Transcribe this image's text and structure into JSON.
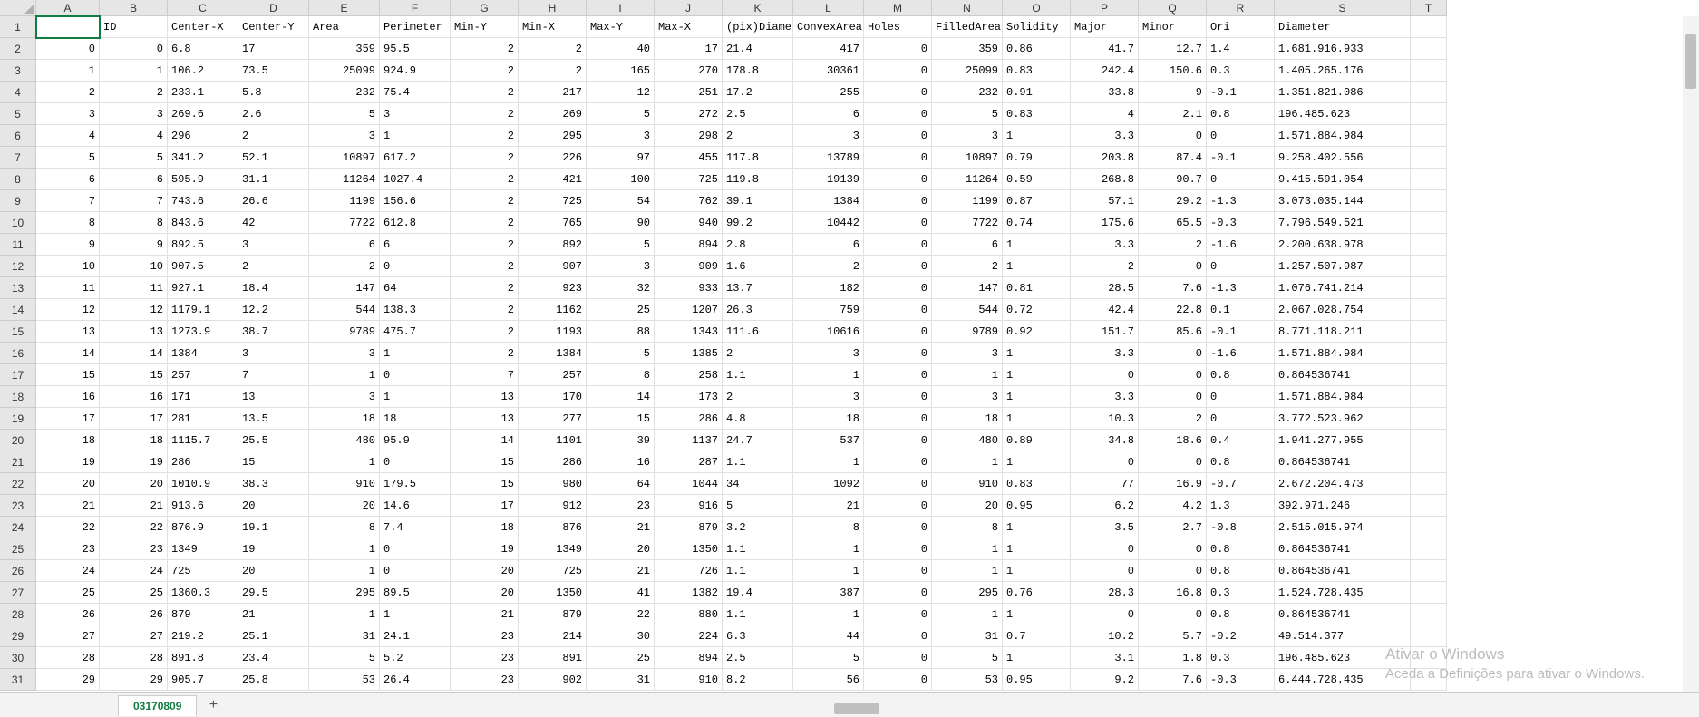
{
  "chart_data": {
    "type": "table",
    "columns": [
      "",
      "ID",
      "Center-X",
      "Center-Y",
      "Area",
      "Perimeter",
      "Min-Y",
      "Min-X",
      "Max-Y",
      "Max-X",
      "(pix)Diame",
      "ConvexArea",
      "Holes",
      "FilledArea",
      "Solidity",
      "Major",
      "Minor",
      "Ori",
      "Diameter"
    ],
    "rows": [
      [
        "0",
        "0",
        "6.8",
        "17",
        "359",
        "95.5",
        "2",
        "2",
        "40",
        "17",
        "21.4",
        "417",
        "0",
        "359",
        "0.86",
        "41.7",
        "12.7",
        "1.4",
        "1.681.916.933"
      ],
      [
        "1",
        "1",
        "106.2",
        "73.5",
        "25099",
        "924.9",
        "2",
        "2",
        "165",
        "270",
        "178.8",
        "30361",
        "0",
        "25099",
        "0.83",
        "242.4",
        "150.6",
        "0.3",
        "1.405.265.176"
      ],
      [
        "2",
        "2",
        "233.1",
        "5.8",
        "232",
        "75.4",
        "2",
        "217",
        "12",
        "251",
        "17.2",
        "255",
        "0",
        "232",
        "0.91",
        "33.8",
        "9",
        "-0.1",
        "1.351.821.086"
      ],
      [
        "3",
        "3",
        "269.6",
        "2.6",
        "5",
        "3",
        "2",
        "269",
        "5",
        "272",
        "2.5",
        "6",
        "0",
        "5",
        "0.83",
        "4",
        "2.1",
        "0.8",
        "196.485.623"
      ],
      [
        "4",
        "4",
        "296",
        "2",
        "3",
        "1",
        "2",
        "295",
        "3",
        "298",
        "2",
        "3",
        "0",
        "3",
        "1",
        "3.3",
        "0",
        "0",
        "1.571.884.984"
      ],
      [
        "5",
        "5",
        "341.2",
        "52.1",
        "10897",
        "617.2",
        "2",
        "226",
        "97",
        "455",
        "117.8",
        "13789",
        "0",
        "10897",
        "0.79",
        "203.8",
        "87.4",
        "-0.1",
        "9.258.402.556"
      ],
      [
        "6",
        "6",
        "595.9",
        "31.1",
        "11264",
        "1027.4",
        "2",
        "421",
        "100",
        "725",
        "119.8",
        "19139",
        "0",
        "11264",
        "0.59",
        "268.8",
        "90.7",
        "0",
        "9.415.591.054"
      ],
      [
        "7",
        "7",
        "743.6",
        "26.6",
        "1199",
        "156.6",
        "2",
        "725",
        "54",
        "762",
        "39.1",
        "1384",
        "0",
        "1199",
        "0.87",
        "57.1",
        "29.2",
        "-1.3",
        "3.073.035.144"
      ],
      [
        "8",
        "8",
        "843.6",
        "42",
        "7722",
        "612.8",
        "2",
        "765",
        "90",
        "940",
        "99.2",
        "10442",
        "0",
        "7722",
        "0.74",
        "175.6",
        "65.5",
        "-0.3",
        "7.796.549.521"
      ],
      [
        "9",
        "9",
        "892.5",
        "3",
        "6",
        "6",
        "2",
        "892",
        "5",
        "894",
        "2.8",
        "6",
        "0",
        "6",
        "1",
        "3.3",
        "2",
        "-1.6",
        "2.200.638.978"
      ],
      [
        "10",
        "10",
        "907.5",
        "2",
        "2",
        "0",
        "2",
        "907",
        "3",
        "909",
        "1.6",
        "2",
        "0",
        "2",
        "1",
        "2",
        "0",
        "0",
        "1.257.507.987"
      ],
      [
        "11",
        "11",
        "927.1",
        "18.4",
        "147",
        "64",
        "2",
        "923",
        "32",
        "933",
        "13.7",
        "182",
        "0",
        "147",
        "0.81",
        "28.5",
        "7.6",
        "-1.3",
        "1.076.741.214"
      ],
      [
        "12",
        "12",
        "1179.1",
        "12.2",
        "544",
        "138.3",
        "2",
        "1162",
        "25",
        "1207",
        "26.3",
        "759",
        "0",
        "544",
        "0.72",
        "42.4",
        "22.8",
        "0.1",
        "2.067.028.754"
      ],
      [
        "13",
        "13",
        "1273.9",
        "38.7",
        "9789",
        "475.7",
        "2",
        "1193",
        "88",
        "1343",
        "111.6",
        "10616",
        "0",
        "9789",
        "0.92",
        "151.7",
        "85.6",
        "-0.1",
        "8.771.118.211"
      ],
      [
        "14",
        "14",
        "1384",
        "3",
        "3",
        "1",
        "2",
        "1384",
        "5",
        "1385",
        "2",
        "3",
        "0",
        "3",
        "1",
        "3.3",
        "0",
        "-1.6",
        "1.571.884.984"
      ],
      [
        "15",
        "15",
        "257",
        "7",
        "1",
        "0",
        "7",
        "257",
        "8",
        "258",
        "1.1",
        "1",
        "0",
        "1",
        "1",
        "0",
        "0",
        "0.8",
        "0.864536741"
      ],
      [
        "16",
        "16",
        "171",
        "13",
        "3",
        "1",
        "13",
        "170",
        "14",
        "173",
        "2",
        "3",
        "0",
        "3",
        "1",
        "3.3",
        "0",
        "0",
        "1.571.884.984"
      ],
      [
        "17",
        "17",
        "281",
        "13.5",
        "18",
        "18",
        "13",
        "277",
        "15",
        "286",
        "4.8",
        "18",
        "0",
        "18",
        "1",
        "10.3",
        "2",
        "0",
        "3.772.523.962"
      ],
      [
        "18",
        "18",
        "1115.7",
        "25.5",
        "480",
        "95.9",
        "14",
        "1101",
        "39",
        "1137",
        "24.7",
        "537",
        "0",
        "480",
        "0.89",
        "34.8",
        "18.6",
        "0.4",
        "1.941.277.955"
      ],
      [
        "19",
        "19",
        "286",
        "15",
        "1",
        "0",
        "15",
        "286",
        "16",
        "287",
        "1.1",
        "1",
        "0",
        "1",
        "1",
        "0",
        "0",
        "0.8",
        "0.864536741"
      ],
      [
        "20",
        "20",
        "1010.9",
        "38.3",
        "910",
        "179.5",
        "15",
        "980",
        "64",
        "1044",
        "34",
        "1092",
        "0",
        "910",
        "0.83",
        "77",
        "16.9",
        "-0.7",
        "2.672.204.473"
      ],
      [
        "21",
        "21",
        "913.6",
        "20",
        "20",
        "14.6",
        "17",
        "912",
        "23",
        "916",
        "5",
        "21",
        "0",
        "20",
        "0.95",
        "6.2",
        "4.2",
        "1.3",
        "392.971.246"
      ],
      [
        "22",
        "22",
        "876.9",
        "19.1",
        "8",
        "7.4",
        "18",
        "876",
        "21",
        "879",
        "3.2",
        "8",
        "0",
        "8",
        "1",
        "3.5",
        "2.7",
        "-0.8",
        "2.515.015.974"
      ],
      [
        "23",
        "23",
        "1349",
        "19",
        "1",
        "0",
        "19",
        "1349",
        "20",
        "1350",
        "1.1",
        "1",
        "0",
        "1",
        "1",
        "0",
        "0",
        "0.8",
        "0.864536741"
      ],
      [
        "24",
        "24",
        "725",
        "20",
        "1",
        "0",
        "20",
        "725",
        "21",
        "726",
        "1.1",
        "1",
        "0",
        "1",
        "1",
        "0",
        "0",
        "0.8",
        "0.864536741"
      ],
      [
        "25",
        "25",
        "1360.3",
        "29.5",
        "295",
        "89.5",
        "20",
        "1350",
        "41",
        "1382",
        "19.4",
        "387",
        "0",
        "295",
        "0.76",
        "28.3",
        "16.8",
        "0.3",
        "1.524.728.435"
      ],
      [
        "26",
        "26",
        "879",
        "21",
        "1",
        "1",
        "21",
        "879",
        "22",
        "880",
        "1.1",
        "1",
        "0",
        "1",
        "1",
        "0",
        "0",
        "0.8",
        "0.864536741"
      ],
      [
        "27",
        "27",
        "219.2",
        "25.1",
        "31",
        "24.1",
        "23",
        "214",
        "30",
        "224",
        "6.3",
        "44",
        "0",
        "31",
        "0.7",
        "10.2",
        "5.7",
        "-0.2",
        "49.514.377"
      ],
      [
        "28",
        "28",
        "891.8",
        "23.4",
        "5",
        "5.2",
        "23",
        "891",
        "25",
        "894",
        "2.5",
        "5",
        "0",
        "5",
        "1",
        "3.1",
        "1.8",
        "0.3",
        "196.485.623"
      ],
      [
        "29",
        "29",
        "905.7",
        "25.8",
        "53",
        "26.4",
        "23",
        "902",
        "31",
        "910",
        "8.2",
        "56",
        "0",
        "53",
        "0.95",
        "9.2",
        "7.6",
        "-0.3",
        "6.444.728.435"
      ]
    ]
  },
  "colLetters": [
    "A",
    "B",
    "C",
    "D",
    "E",
    "F",
    "G",
    "H",
    "I",
    "J",
    "K",
    "L",
    "M",
    "N",
    "O",
    "P",
    "Q",
    "R",
    "S",
    "T"
  ],
  "rowNumbers": [
    "1",
    "2",
    "3",
    "4",
    "5",
    "6",
    "7",
    "8",
    "9",
    "10",
    "11",
    "12",
    "13",
    "14",
    "15",
    "16",
    "17",
    "18",
    "19",
    "20",
    "21",
    "22",
    "23",
    "24",
    "25",
    "26",
    "27",
    "28",
    "29",
    "30",
    "31"
  ],
  "numericCols": [
    0,
    1,
    4,
    6,
    7,
    8,
    9,
    11,
    12,
    13,
    15,
    16
  ],
  "sheetTab": "03170809",
  "addTab": "+",
  "watermark": {
    "line1": "Ativar o Windows",
    "line2": "Aceda a Definições para ativar o Windows."
  }
}
